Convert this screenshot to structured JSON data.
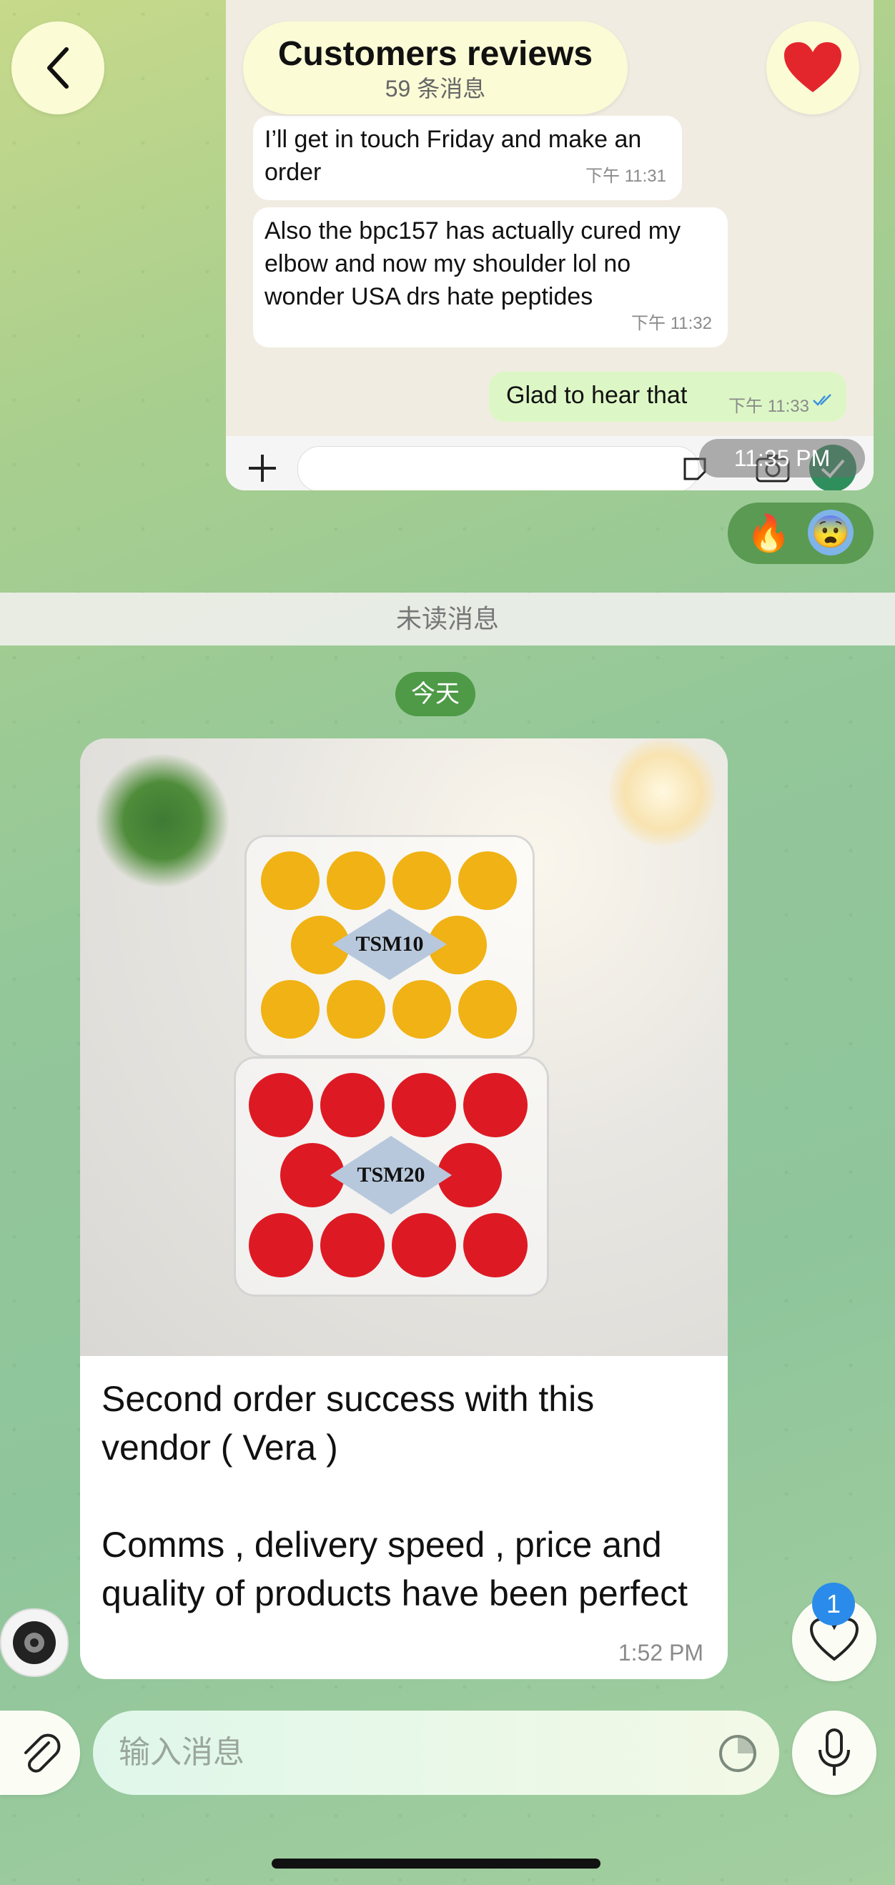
{
  "header": {
    "title": "Customers reviews",
    "subtitle": "59 条消息"
  },
  "inner_chat": {
    "messages": [
      {
        "text": "I’ll get in touch Friday and make an order",
        "time": "下午 11:31"
      },
      {
        "text": "Also the bpc157 has actually cured my elbow and now my shoulder lol no wonder USA drs hate peptides",
        "time": "下午 11:32"
      },
      {
        "text": "Glad to hear that",
        "time": "下午 11:33"
      }
    ],
    "overlay_time": "11:35 PM"
  },
  "reactions": [
    "🔥",
    "😨"
  ],
  "unread_label": "未读消息",
  "date_label": "今天",
  "main_message": {
    "photo_labels": [
      "TSM10",
      "TSM20"
    ],
    "text_line1": "Second order success with this vendor ( Vera )",
    "text_line2": "Comms , delivery speed , price and quality of products have been perfect",
    "time": "1:52 PM"
  },
  "reactions_button": {
    "badge": "1"
  },
  "input": {
    "placeholder": "输入消息"
  },
  "colors": {
    "accent_green": "#4e9a47",
    "badge_blue": "#2a8bea",
    "heart_red": "#e3262c"
  },
  "icons": [
    "back-chevron-icon",
    "heart-icon",
    "plus-icon",
    "sticker-icon",
    "camera-icon",
    "mic-icon",
    "paperclip-icon",
    "emoji-timer-icon",
    "reaction-heart-icon",
    "checkmark-icon"
  ]
}
